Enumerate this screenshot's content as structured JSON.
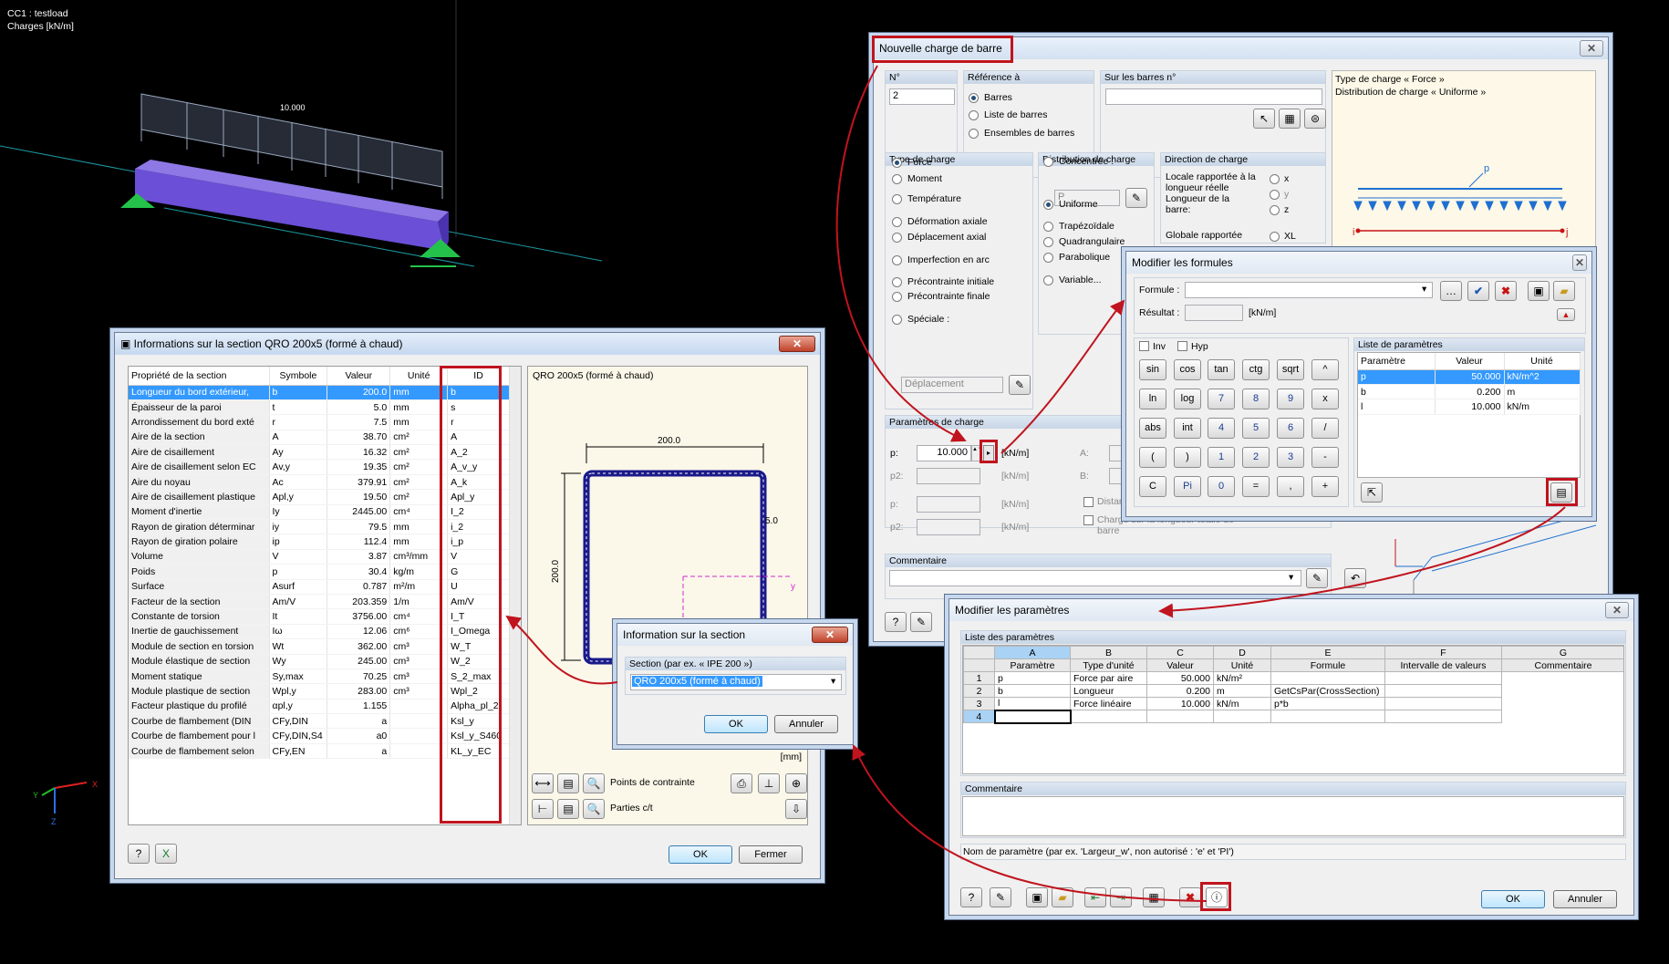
{
  "viewport": {
    "case_label": "CC1 : testload",
    "units_label": "Charges [kN/m]",
    "load_value": "10.000",
    "axis_x": "X",
    "axis_y": "Y",
    "axis_z": "Z"
  },
  "section_info": {
    "title": "Informations sur la section QRO 200x5 (formé à chaud)",
    "columns": [
      "Propriété de la section",
      "Symbole",
      "Valeur",
      "Unité",
      "ID"
    ],
    "rows": [
      [
        "Longueur du bord extérieur,",
        "b",
        "200.0",
        "mm",
        "b"
      ],
      [
        "Épaisseur de la paroi",
        "t",
        "5.0",
        "mm",
        "s"
      ],
      [
        "Arrondissement du bord exté",
        "r",
        "7.5",
        "mm",
        "r"
      ],
      [
        "Aire de la section",
        "A",
        "38.70",
        "cm²",
        "A"
      ],
      [
        "Aire de cisaillement",
        "Ay",
        "16.32",
        "cm²",
        "A_2"
      ],
      [
        "Aire de cisaillement selon EC",
        "Av,y",
        "19.35",
        "cm²",
        "A_v_y"
      ],
      [
        "Aire du noyau",
        "Ac",
        "379.91",
        "cm²",
        "A_k"
      ],
      [
        "Aire de cisaillement plastique",
        "Apl,y",
        "19.50",
        "cm²",
        "Apl_y"
      ],
      [
        "Moment d'inertie",
        "Iy",
        "2445.00",
        "cm⁴",
        "I_2"
      ],
      [
        "Rayon de giration déterminar",
        "iy",
        "79.5",
        "mm",
        "i_2"
      ],
      [
        "Rayon de giration polaire",
        "ip",
        "112.4",
        "mm",
        "i_p"
      ],
      [
        "Volume",
        "V",
        "3.87",
        "cm³/mm",
        "V"
      ],
      [
        "Poids",
        "p",
        "30.4",
        "kg/m",
        "G"
      ],
      [
        "Surface",
        "Asurf",
        "0.787",
        "m²/m",
        "U"
      ],
      [
        "Facteur de la section",
        "Am/V",
        "203.359",
        "1/m",
        "Am/V"
      ],
      [
        "Constante de torsion",
        "It",
        "3756.00",
        "cm⁴",
        "I_T"
      ],
      [
        "Inertie de gauchissement",
        "Iω",
        "12.06",
        "cm⁶",
        "I_Omega"
      ],
      [
        "Module de section en torsion",
        "Wt",
        "362.00",
        "cm³",
        "W_T"
      ],
      [
        "Module élastique de section",
        "Wy",
        "245.00",
        "cm³",
        "W_2"
      ],
      [
        "Moment statique",
        "Sy,max",
        "70.25",
        "cm³",
        "S_2_max"
      ],
      [
        "Module plastique de section",
        "Wpl,y",
        "283.00",
        "cm³",
        "Wpl_2"
      ],
      [
        "Facteur plastique du profilé",
        "αpl,y",
        "1.155",
        "",
        "Alpha_pl_2"
      ],
      [
        "Courbe de flambement (DIN",
        "CFy,DIN",
        "a",
        "",
        "Ksl_y"
      ],
      [
        "Courbe de flambement pour l",
        "CFy,DIN,S4",
        "a0",
        "",
        "Ksl_y_S460"
      ],
      [
        "Courbe de flambement selon",
        "CFy,EN",
        "a",
        "",
        "KL_y_EC"
      ]
    ],
    "drawing_title": "QRO 200x5 (formé à chaud)",
    "dim_width": "200.0",
    "dim_height": "200.0",
    "dim_thick": "5.0",
    "axis_y": "y",
    "unit": "[mm]",
    "stress_points": "Points de contrainte",
    "parts": "Parties c/t",
    "ok": "OK",
    "close": "Fermer"
  },
  "load_dialog": {
    "title": "Nouvelle charge de barre",
    "n_label": "N°",
    "n_value": "2",
    "ref_label": "Référence à",
    "ref_options": [
      "Barres",
      "Liste de barres",
      "Ensembles de barres"
    ],
    "on_bars_label": "Sur les barres n°",
    "type_label": "Type de charge",
    "types": [
      "Force",
      "Moment",
      "Température",
      "Déformation axiale",
      "Déplacement axial",
      "Imperfection en arc",
      "Précontrainte initiale",
      "Précontrainte finale",
      "Spéciale :"
    ],
    "special_value": "Déplacement",
    "distrib_label": "Distribution de charge",
    "distribs": [
      "Concentrée :",
      "Uniforme",
      "Trapézoïdale",
      "Quadrangulaire",
      "Parabolique",
      "Variable..."
    ],
    "concentrated_value": "P",
    "direction_label": "Direction de charge",
    "direction_local": "Locale rapportée à la longueur réelle Longueur de la barre:",
    "direction_global": "Globale rapportée",
    "dir_options": [
      "x",
      "y",
      "z",
      "XL"
    ],
    "info_line1": "Type de charge « Force »",
    "info_line2": "Distribution de charge « Uniforme »",
    "diagram_p": "p",
    "diagram_i": "i",
    "diagram_j": "j",
    "params_label": "Paramètres de charge",
    "p_label": "p:",
    "p_value": "10.000",
    "p_unit": "[kN/m]",
    "p2_label": "p2:",
    "p2_unit": "[kN/m]",
    "a_label": "A:",
    "b_label": "B:",
    "distance_label": "Distan",
    "charge_total": "Charge sur la longueur totale de barre",
    "comment_label": "Commentaire"
  },
  "formula_dialog": {
    "title": "Modifier les formules",
    "formula_label": "Formule :",
    "result_label": "Résultat :",
    "result_unit": "[kN/m]",
    "inv": "Inv",
    "hyp": "Hyp",
    "keys": [
      [
        "sin",
        "cos",
        "tan",
        "ctg",
        "sqrt",
        "^"
      ],
      [
        "ln",
        "log",
        "7",
        "8",
        "9",
        "x"
      ],
      [
        "abs",
        "int",
        "4",
        "5",
        "6",
        "/"
      ],
      [
        "(",
        ")",
        "1",
        "2",
        "3",
        "-"
      ],
      [
        "C",
        "Pi",
        "0",
        "=",
        ",",
        "+"
      ]
    ],
    "params_label": "Liste de paramètres",
    "param_cols": [
      "Paramètre",
      "Valeur",
      "Unité"
    ],
    "params": [
      [
        "p",
        "50.000",
        "kN/m^2"
      ],
      [
        "b",
        "0.200",
        "m"
      ],
      [
        "l",
        "10.000",
        "kN/m"
      ]
    ]
  },
  "edit_params": {
    "title": "Modifier les paramètres",
    "list_label": "Liste des paramètres",
    "letters": [
      "A",
      "B",
      "C",
      "D",
      "E",
      "F",
      "G"
    ],
    "cols": [
      "Paramètre",
      "Type d'unité",
      "Valeur",
      "Unité",
      "Formule",
      "Intervalle de valeurs",
      "Commentaire"
    ],
    "rows": [
      [
        "1",
        "p",
        "Force par aire",
        "50.000",
        "kN/m²",
        "",
        ""
      ],
      [
        "2",
        "b",
        "Longueur",
        "0.200",
        "m",
        "GetCsPar(CrossSection)",
        ""
      ],
      [
        "3",
        "l",
        "Force linéaire",
        "10.000",
        "kN/m",
        "p*b",
        ""
      ],
      [
        "4",
        "",
        "",
        "",
        "",
        "",
        ""
      ]
    ],
    "comment_label": "Commentaire",
    "hint": "Nom de paramètre (par ex. 'Largeur_w', non autorisé : 'e' et 'PI')",
    "ok": "OK",
    "cancel": "Annuler"
  },
  "section_popup": {
    "title": "Information sur la section",
    "group_label": "Section (par ex. « IPE 200 »)",
    "value": "QRO 200x5 (formé à chaud)",
    "ok": "OK",
    "cancel": "Annuler"
  },
  "colors": {
    "highlight": "#c0141e",
    "selection": "#3399ff",
    "title_gradient": "#c6d8ef"
  }
}
